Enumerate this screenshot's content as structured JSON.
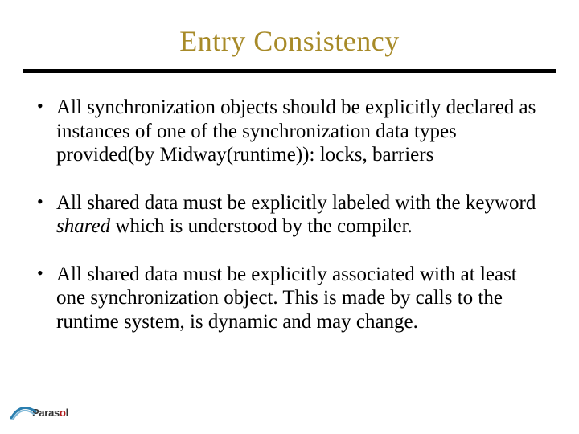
{
  "title": "Entry  Consistency",
  "bullets": [
    {
      "text_before": "All synchronization objects should be explicitly declared as instances of one of the synchronization data types provided(by Midway(runtime)): locks, barriers",
      "italic": "",
      "text_after": ""
    },
    {
      "text_before": "All shared data must be explicitly labeled with the keyword ",
      "italic": "shared ",
      "text_after": " which is understood by the compiler."
    },
    {
      "text_before": "All shared data must be explicitly associated with at least one synchronization object. This is made by calls to the runtime system, is dynamic and may change.",
      "italic": "",
      "text_after": ""
    }
  ],
  "logo": {
    "p": "P",
    "aras": "aras",
    "o": "o",
    "l": "l"
  }
}
